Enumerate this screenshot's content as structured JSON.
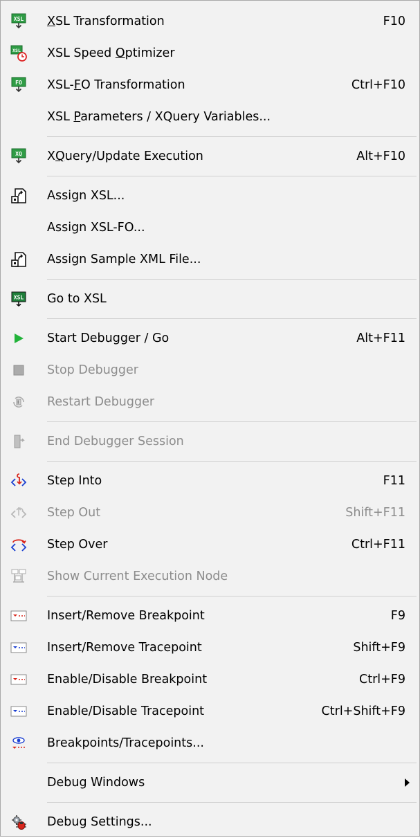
{
  "menu": {
    "entries": [
      {
        "type": "item",
        "label": "XSL Transformation",
        "ul": 0,
        "shortcut": "F10",
        "icon": "xsl-transform-icon",
        "enabled": true
      },
      {
        "type": "item",
        "label": "XSL Speed Optimizer",
        "ul": 10,
        "shortcut": "",
        "icon": "xsl-speed-optimizer-icon",
        "enabled": true
      },
      {
        "type": "item",
        "label": "XSL-FO Transformation",
        "ul": 4,
        "shortcut": "Ctrl+F10",
        "icon": "xsl-fo-transform-icon",
        "enabled": true
      },
      {
        "type": "item",
        "label": "XSL Parameters / XQuery Variables...",
        "ul": 4,
        "shortcut": "",
        "icon": "",
        "enabled": true
      },
      {
        "type": "separator"
      },
      {
        "type": "item",
        "label": "XQuery/Update Execution",
        "ul": 1,
        "shortcut": "Alt+F10",
        "icon": "xquery-execution-icon",
        "enabled": true
      },
      {
        "type": "separator"
      },
      {
        "type": "item",
        "label": "Assign XSL...",
        "ul": -1,
        "shortcut": "",
        "icon": "assign-file-icon",
        "enabled": true
      },
      {
        "type": "item",
        "label": "Assign XSL-FO...",
        "ul": -1,
        "shortcut": "",
        "icon": "",
        "enabled": true
      },
      {
        "type": "item",
        "label": "Assign Sample XML File...",
        "ul": -1,
        "shortcut": "",
        "icon": "assign-file-icon",
        "enabled": true
      },
      {
        "type": "separator"
      },
      {
        "type": "item",
        "label": "Go to XSL",
        "ul": -1,
        "shortcut": "",
        "icon": "go-to-xsl-icon",
        "enabled": true
      },
      {
        "type": "separator"
      },
      {
        "type": "item",
        "label": "Start Debugger / Go",
        "ul": -1,
        "shortcut": "Alt+F11",
        "icon": "play-icon",
        "enabled": true
      },
      {
        "type": "item",
        "label": "Stop Debugger",
        "ul": -1,
        "shortcut": "",
        "icon": "stop-icon",
        "enabled": false
      },
      {
        "type": "item",
        "label": "Restart Debugger",
        "ul": -1,
        "shortcut": "",
        "icon": "restart-icon",
        "enabled": false
      },
      {
        "type": "separator"
      },
      {
        "type": "item",
        "label": "End Debugger Session",
        "ul": -1,
        "shortcut": "",
        "icon": "end-session-icon",
        "enabled": false
      },
      {
        "type": "separator"
      },
      {
        "type": "item",
        "label": "Step Into",
        "ul": -1,
        "shortcut": "F11",
        "icon": "step-into-icon",
        "enabled": true
      },
      {
        "type": "item",
        "label": "Step Out",
        "ul": -1,
        "shortcut": "Shift+F11",
        "icon": "step-out-icon",
        "enabled": false
      },
      {
        "type": "item",
        "label": "Step Over",
        "ul": -1,
        "shortcut": "Ctrl+F11",
        "icon": "step-over-icon",
        "enabled": true
      },
      {
        "type": "item",
        "label": "Show Current Execution Node",
        "ul": -1,
        "shortcut": "",
        "icon": "execution-node-icon",
        "enabled": false
      },
      {
        "type": "separator"
      },
      {
        "type": "item",
        "label": "Insert/Remove Breakpoint",
        "ul": -1,
        "shortcut": "F9",
        "icon": "breakpoint-icon",
        "enabled": true
      },
      {
        "type": "item",
        "label": "Insert/Remove Tracepoint",
        "ul": -1,
        "shortcut": "Shift+F9",
        "icon": "tracepoint-icon",
        "enabled": true
      },
      {
        "type": "item",
        "label": "Enable/Disable Breakpoint",
        "ul": -1,
        "shortcut": "Ctrl+F9",
        "icon": "breakpoint-icon",
        "enabled": true
      },
      {
        "type": "item",
        "label": "Enable/Disable Tracepoint",
        "ul": -1,
        "shortcut": "Ctrl+Shift+F9",
        "icon": "tracepoint-icon",
        "enabled": true
      },
      {
        "type": "item",
        "label": "Breakpoints/Tracepoints...",
        "ul": -1,
        "shortcut": "",
        "icon": "breakpoints-dialog-icon",
        "enabled": true
      },
      {
        "type": "separator"
      },
      {
        "type": "item",
        "label": "Debug Windows",
        "ul": -1,
        "shortcut": "",
        "icon": "",
        "enabled": true,
        "submenu": true
      },
      {
        "type": "separator"
      },
      {
        "type": "item",
        "label": "Debug Settings...",
        "ul": -1,
        "shortcut": "",
        "icon": "debug-settings-icon",
        "enabled": true
      }
    ]
  },
  "colors": {
    "menu_bg": "#f2f2f2",
    "disabled_text": "#8c8c8c",
    "separator": "#cfcfcf",
    "accent_green": "#1f9a3c",
    "breakpoint_red": "#d9261c",
    "tracepoint_blue": "#1a3fd1"
  }
}
